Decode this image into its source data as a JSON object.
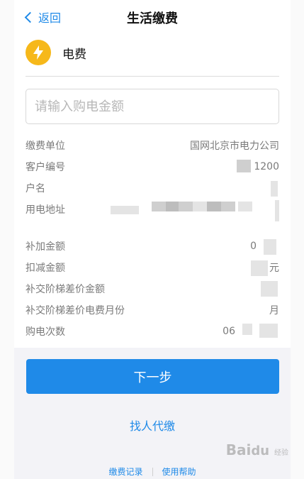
{
  "nav": {
    "back_label": "返回",
    "title": "生活缴费"
  },
  "service": {
    "icon": "lightning-bolt-icon",
    "label": "电费",
    "icon_color": "#f6b81a"
  },
  "amount_input": {
    "placeholder": "请输入购电金额",
    "value": ""
  },
  "info_rows": [
    {
      "key": "缴费单位",
      "value": "国网北京市电力公司"
    },
    {
      "key": "客户编号",
      "value": "1200"
    },
    {
      "key": "户名",
      "value": ""
    },
    {
      "key": "用电地址",
      "value": ""
    }
  ],
  "fee_rows": [
    {
      "key": "补加金额",
      "value": "0"
    },
    {
      "key": "扣减金额",
      "value": "元"
    },
    {
      "key": "补交阶梯差价金额",
      "value": ""
    },
    {
      "key": "补交阶梯差价电费月份",
      "value": "月"
    },
    {
      "key": "购电次数",
      "value": "06"
    }
  ],
  "actions": {
    "next_label": "下一步",
    "proxy_pay_label": "找人代缴"
  },
  "footer": {
    "records_label": "缴费记录",
    "help_label": "使用帮助"
  },
  "colors": {
    "accent": "#1f8ae8",
    "bottom_bg": "#f3f3f7"
  }
}
